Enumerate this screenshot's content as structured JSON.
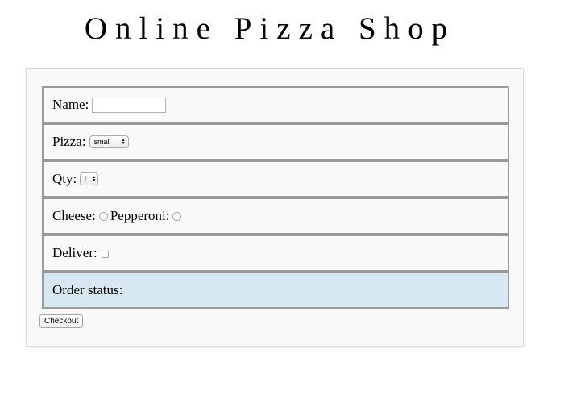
{
  "page": {
    "title": "Online Pizza Shop"
  },
  "form": {
    "name": {
      "label": "Name:",
      "value": ""
    },
    "pizza": {
      "label": "Pizza:",
      "selected": "small"
    },
    "qty": {
      "label": "Qty:",
      "selected": "1"
    },
    "toppings": {
      "cheese_label": "Cheese:",
      "cheese_checked": false,
      "pepperoni_label": "Pepperoni:",
      "pepperoni_checked": false
    },
    "deliver": {
      "label": "Deliver:",
      "checked": false
    },
    "status": {
      "label": "Order status:",
      "value": ""
    },
    "checkout_label": "Checkout"
  },
  "icons": {
    "select_arrows": "up-down-arrows-icon"
  },
  "colors": {
    "row_border": "#9a9a9a",
    "status_background": "#d8e8f2",
    "panel_background": "#f9f9f9"
  }
}
